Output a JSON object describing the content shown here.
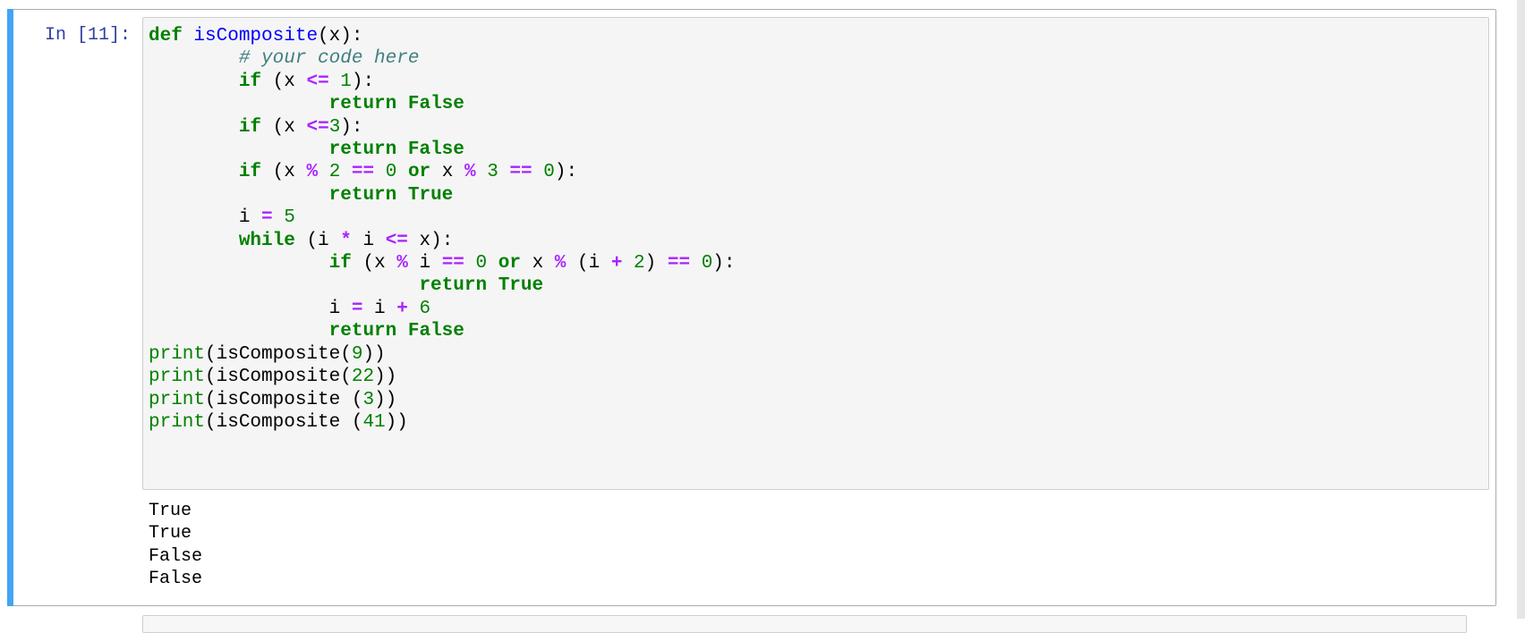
{
  "cell": {
    "prompt": "In [11]:",
    "code_lines": [
      [
        {
          "t": "kw",
          "v": "def"
        },
        {
          "t": "",
          "v": " "
        },
        {
          "t": "fn",
          "v": "isComposite"
        },
        {
          "t": "",
          "v": "(x):"
        }
      ],
      [
        {
          "t": "",
          "v": "        "
        },
        {
          "t": "cm",
          "v": "# your code here"
        }
      ],
      [
        {
          "t": "",
          "v": "        "
        },
        {
          "t": "kw",
          "v": "if"
        },
        {
          "t": "",
          "v": " (x "
        },
        {
          "t": "op",
          "v": "<="
        },
        {
          "t": "",
          "v": " "
        },
        {
          "t": "num",
          "v": "1"
        },
        {
          "t": "",
          "v": "):"
        }
      ],
      [
        {
          "t": "",
          "v": "                "
        },
        {
          "t": "kw",
          "v": "return"
        },
        {
          "t": "",
          "v": " "
        },
        {
          "t": "kw",
          "v": "False"
        }
      ],
      [
        {
          "t": "",
          "v": "        "
        },
        {
          "t": "kw",
          "v": "if"
        },
        {
          "t": "",
          "v": " (x "
        },
        {
          "t": "op",
          "v": "<="
        },
        {
          "t": "num",
          "v": "3"
        },
        {
          "t": "",
          "v": "):"
        }
      ],
      [
        {
          "t": "",
          "v": "                "
        },
        {
          "t": "kw",
          "v": "return"
        },
        {
          "t": "",
          "v": " "
        },
        {
          "t": "kw",
          "v": "False"
        }
      ],
      [
        {
          "t": "",
          "v": "        "
        },
        {
          "t": "kw",
          "v": "if"
        },
        {
          "t": "",
          "v": " (x "
        },
        {
          "t": "op",
          "v": "%"
        },
        {
          "t": "",
          "v": " "
        },
        {
          "t": "num",
          "v": "2"
        },
        {
          "t": "",
          "v": " "
        },
        {
          "t": "op",
          "v": "=="
        },
        {
          "t": "",
          "v": " "
        },
        {
          "t": "num",
          "v": "0"
        },
        {
          "t": "",
          "v": " "
        },
        {
          "t": "kw",
          "v": "or"
        },
        {
          "t": "",
          "v": " x "
        },
        {
          "t": "op",
          "v": "%"
        },
        {
          "t": "",
          "v": " "
        },
        {
          "t": "num",
          "v": "3"
        },
        {
          "t": "",
          "v": " "
        },
        {
          "t": "op",
          "v": "=="
        },
        {
          "t": "",
          "v": " "
        },
        {
          "t": "num",
          "v": "0"
        },
        {
          "t": "",
          "v": "):"
        }
      ],
      [
        {
          "t": "",
          "v": "                "
        },
        {
          "t": "kw",
          "v": "return"
        },
        {
          "t": "",
          "v": " "
        },
        {
          "t": "kw",
          "v": "True"
        }
      ],
      [
        {
          "t": "",
          "v": "        i "
        },
        {
          "t": "op",
          "v": "="
        },
        {
          "t": "",
          "v": " "
        },
        {
          "t": "num",
          "v": "5"
        }
      ],
      [
        {
          "t": "",
          "v": "        "
        },
        {
          "t": "kw",
          "v": "while"
        },
        {
          "t": "",
          "v": " (i "
        },
        {
          "t": "op",
          "v": "*"
        },
        {
          "t": "",
          "v": " i "
        },
        {
          "t": "op",
          "v": "<="
        },
        {
          "t": "",
          "v": " x):"
        }
      ],
      [
        {
          "t": "",
          "v": "                "
        },
        {
          "t": "kw",
          "v": "if"
        },
        {
          "t": "",
          "v": " (x "
        },
        {
          "t": "op",
          "v": "%"
        },
        {
          "t": "",
          "v": " i "
        },
        {
          "t": "op",
          "v": "=="
        },
        {
          "t": "",
          "v": " "
        },
        {
          "t": "num",
          "v": "0"
        },
        {
          "t": "",
          "v": " "
        },
        {
          "t": "kw",
          "v": "or"
        },
        {
          "t": "",
          "v": " x "
        },
        {
          "t": "op",
          "v": "%"
        },
        {
          "t": "",
          "v": " (i "
        },
        {
          "t": "op",
          "v": "+"
        },
        {
          "t": "",
          "v": " "
        },
        {
          "t": "num",
          "v": "2"
        },
        {
          "t": "",
          "v": ") "
        },
        {
          "t": "op",
          "v": "=="
        },
        {
          "t": "",
          "v": " "
        },
        {
          "t": "num",
          "v": "0"
        },
        {
          "t": "",
          "v": "):"
        }
      ],
      [
        {
          "t": "",
          "v": "                        "
        },
        {
          "t": "kw",
          "v": "return"
        },
        {
          "t": "",
          "v": " "
        },
        {
          "t": "kw",
          "v": "True"
        }
      ],
      [
        {
          "t": "",
          "v": "                i "
        },
        {
          "t": "op",
          "v": "="
        },
        {
          "t": "",
          "v": " i "
        },
        {
          "t": "op",
          "v": "+"
        },
        {
          "t": "",
          "v": " "
        },
        {
          "t": "num",
          "v": "6"
        }
      ],
      [
        {
          "t": "",
          "v": "                "
        },
        {
          "t": "kw",
          "v": "return"
        },
        {
          "t": "",
          "v": " "
        },
        {
          "t": "kw",
          "v": "False"
        }
      ],
      [
        {
          "t": "bi",
          "v": "print"
        },
        {
          "t": "",
          "v": "(isComposite("
        },
        {
          "t": "num",
          "v": "9"
        },
        {
          "t": "",
          "v": "))"
        }
      ],
      [
        {
          "t": "bi",
          "v": "print"
        },
        {
          "t": "",
          "v": "(isComposite("
        },
        {
          "t": "num",
          "v": "22"
        },
        {
          "t": "",
          "v": "))"
        }
      ],
      [
        {
          "t": "bi",
          "v": "print"
        },
        {
          "t": "",
          "v": "(isComposite ("
        },
        {
          "t": "num",
          "v": "3"
        },
        {
          "t": "",
          "v": "))"
        }
      ],
      [
        {
          "t": "bi",
          "v": "print"
        },
        {
          "t": "",
          "v": "(isComposite ("
        },
        {
          "t": "num",
          "v": "41"
        },
        {
          "t": "",
          "v": "))"
        }
      ]
    ],
    "output_lines": [
      "True",
      "True",
      "False",
      "False"
    ]
  }
}
